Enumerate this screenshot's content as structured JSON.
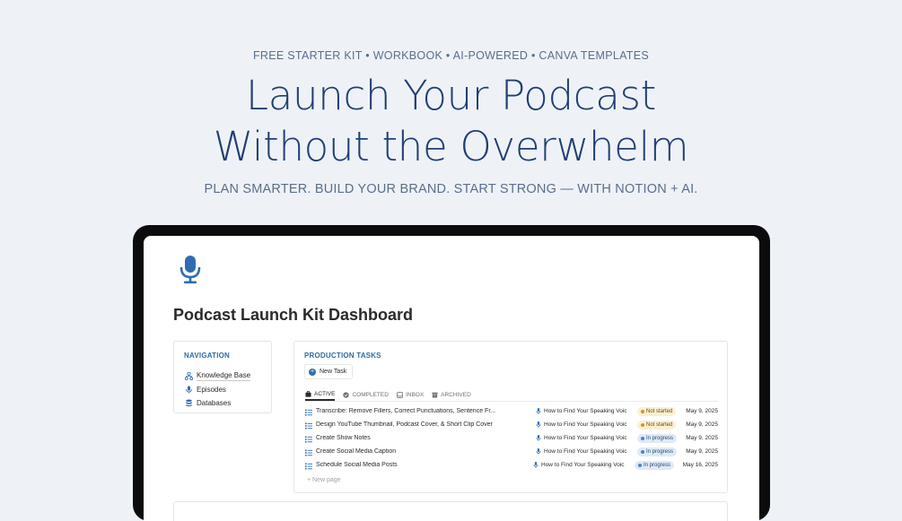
{
  "hero": {
    "tagline": "FREE STARTER KIT • WORKBOOK • AI-POWERED • CANVA TEMPLATES",
    "title_line1": "Launch Your Podcast",
    "title_line2": "Without the Overwhelm",
    "subtitle": "PLAN SMARTER. BUILD YOUR BRAND. START STRONG — WITH NOTION + AI."
  },
  "colors": {
    "background": "#eef2f7",
    "title": "#1f3f73",
    "accent": "#2e6da4",
    "not_started": "#fbefd0",
    "in_progress": "#dfeaf6"
  },
  "dashboard": {
    "page_icon": "microphone-icon",
    "title": "Podcast Launch Kit Dashboard",
    "navigation": {
      "heading": "NAVIGATION",
      "items": [
        {
          "label": "Knowledge Base",
          "icon": "sitemap-icon"
        },
        {
          "label": "Episodes",
          "icon": "microphone-icon"
        },
        {
          "label": "Databases",
          "icon": "database-icon"
        }
      ]
    },
    "tasks": {
      "heading": "PRODUCTION TASKS",
      "new_task_label": "New Task",
      "tabs": [
        {
          "label": "ACTIVE",
          "icon": "briefcase-icon",
          "active": true
        },
        {
          "label": "COMPLETED",
          "icon": "check-circle-icon",
          "active": false
        },
        {
          "label": "INBOX",
          "icon": "inbox-icon",
          "active": false
        },
        {
          "label": "ARCHIVED",
          "icon": "archive-icon",
          "active": false
        }
      ],
      "rows": [
        {
          "title": "Transcribe: Remove Fillers, Correct Punctuations, Sentence Fr...",
          "episode": "How to Find Your Speaking Voic",
          "status": "Not started",
          "date": "May 9, 2025"
        },
        {
          "title": "Design YouTube Thumbnail, Podcast Cover, & Short Clip Cover",
          "episode": "How to Find Your Speaking Voic",
          "status": "Not started",
          "date": "May 9, 2025"
        },
        {
          "title": "Create Show Notes",
          "episode": "How to Find Your Speaking Voic",
          "status": "In progress",
          "date": "May 9, 2025"
        },
        {
          "title": "Create Social Media Caption",
          "episode": "How to Find Your Speaking Voic",
          "status": "In progress",
          "date": "May 9, 2025"
        },
        {
          "title": "Schedule Social Media Posts",
          "episode": "How to Find Your Speaking Voic",
          "status": "In progress",
          "date": "May 16, 2025"
        }
      ],
      "new_page_label": "New page"
    }
  }
}
